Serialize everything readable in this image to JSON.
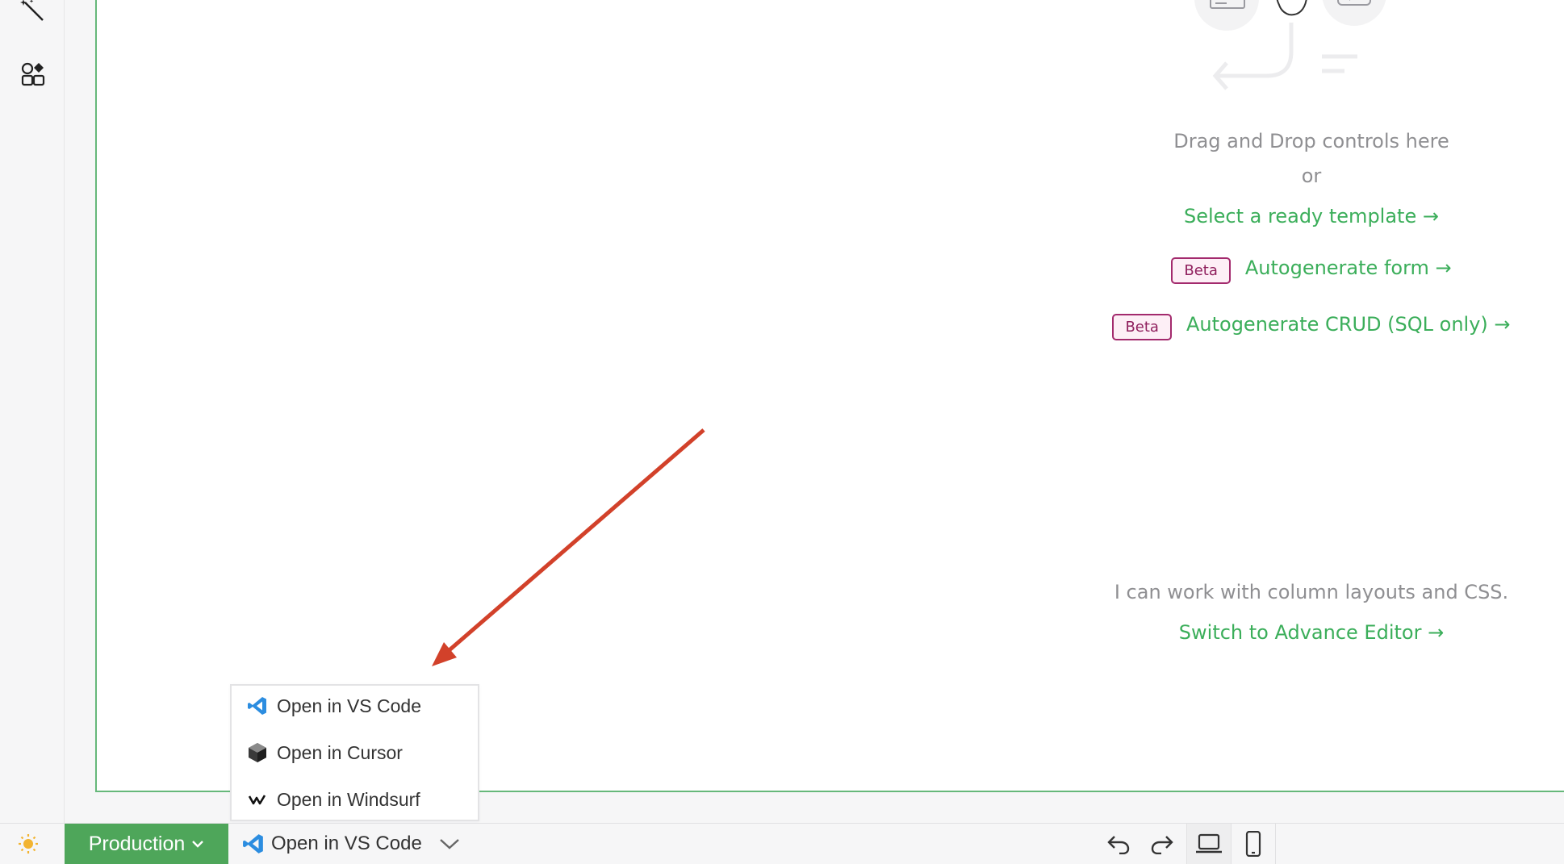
{
  "canvas": {
    "drop_text": "Drag and Drop controls here",
    "or_text": "or",
    "select_template": "Select a ready template",
    "autogen_form_badge": "Beta",
    "autogen_form": "Autogenerate form",
    "autogen_crud_badge": "Beta",
    "autogen_crud": "Autogenerate CRUD (SQL only)",
    "columns_text": "I can work with column layouts and CSS.",
    "switch_advanced": "Switch to Advance Editor",
    "arrow_glyph": "→"
  },
  "dropdown": {
    "items": [
      {
        "label": "Open in VS Code",
        "icon": "vscode-icon"
      },
      {
        "label": "Open in Cursor",
        "icon": "cursor-icon"
      },
      {
        "label": "Open in Windsurf",
        "icon": "windsurf-icon"
      }
    ]
  },
  "bottombar": {
    "environment": "Production",
    "open_in": "Open in VS Code"
  },
  "colors": {
    "accent_green": "#3bae5a",
    "production_green": "#4ea65a",
    "beta_border": "#a32a6d",
    "annotation_arrow": "#d2412a"
  }
}
